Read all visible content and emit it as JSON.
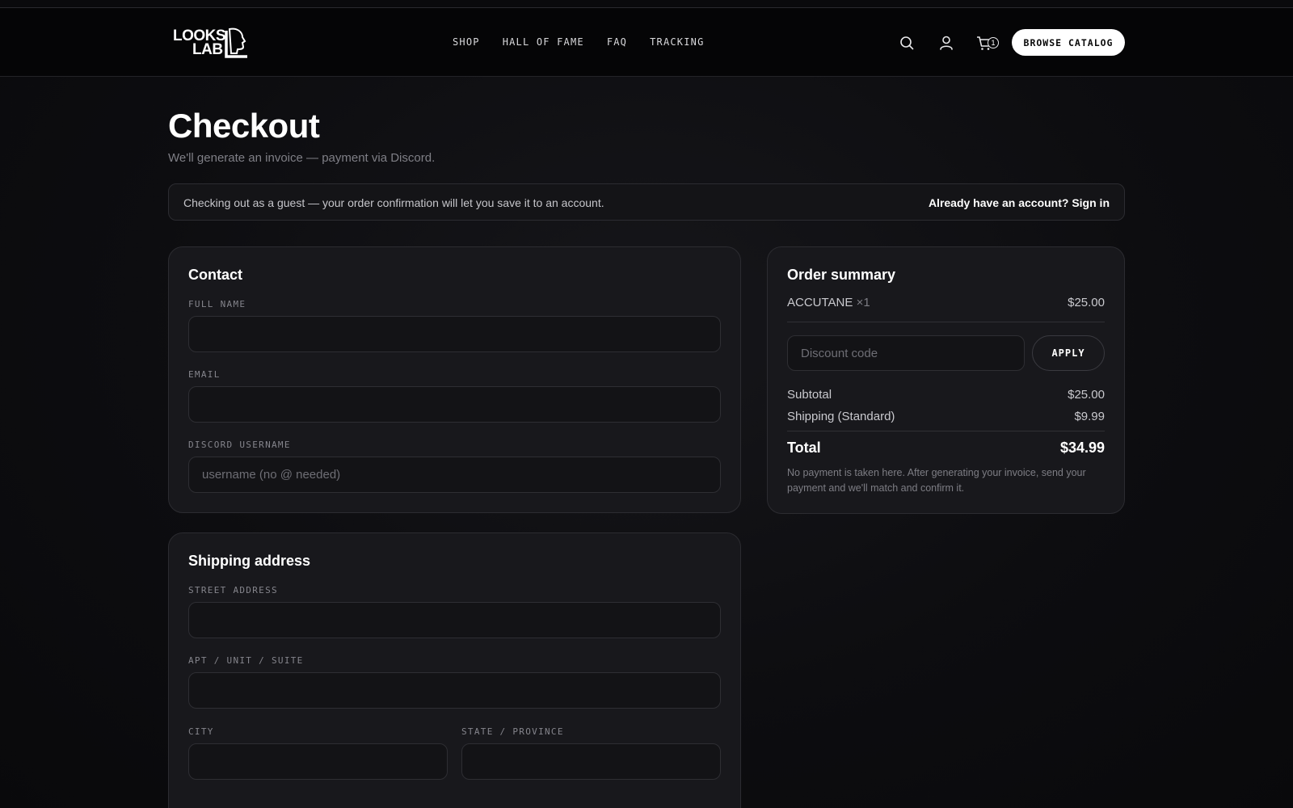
{
  "header": {
    "logo": {
      "line1": "LOOKS",
      "line2": "LAB"
    },
    "nav": [
      "SHOP",
      "HALL OF FAME",
      "FAQ",
      "TRACKING"
    ],
    "cart_count": "1",
    "browse_label": "BROWSE CATALOG",
    "icons": [
      "search-icon",
      "user-icon",
      "cart-icon"
    ]
  },
  "page": {
    "title": "Checkout",
    "subtitle": "We'll generate an invoice — payment via Discord."
  },
  "guest_bar": {
    "message": "Checking out as a guest — your order confirmation will let you save it to an account.",
    "signin": "Already have an account? Sign in"
  },
  "contact": {
    "heading": "Contact",
    "full_name_label": "FULL NAME",
    "email_label": "EMAIL",
    "discord_label": "DISCORD USERNAME",
    "discord_placeholder": "username (no @ needed)"
  },
  "shipping": {
    "heading": "Shipping address",
    "street_label": "STREET ADDRESS",
    "apt_label": "APT / UNIT / SUITE",
    "city_label": "CITY",
    "state_label": "STATE / PROVINCE"
  },
  "summary": {
    "heading": "Order summary",
    "item_name": "ACCUTANE",
    "item_qty": "×1",
    "item_price": "$25.00",
    "discount_placeholder": "Discount code",
    "apply_label": "APPLY",
    "subtotal_label": "Subtotal",
    "subtotal_value": "$25.00",
    "shipping_label": "Shipping (Standard)",
    "shipping_value": "$9.99",
    "total_label": "Total",
    "total_value": "$34.99",
    "note": "No payment is taken here. After generating your invoice, send your payment and we'll match and confirm it."
  },
  "colors": {
    "background": "#0d0d10",
    "card": "#18181c",
    "accent": "#ffffff"
  }
}
